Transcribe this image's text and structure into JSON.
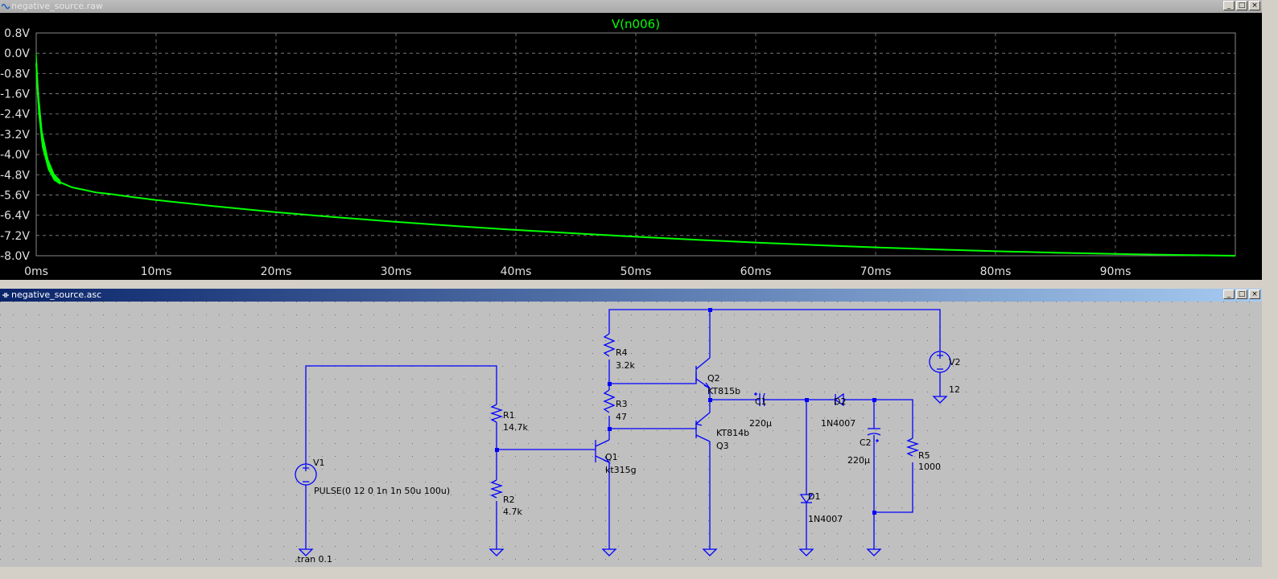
{
  "plot_window": {
    "title": "negative_source.raw",
    "buttons": [
      "_",
      "□",
      "×"
    ]
  },
  "schematic_window": {
    "title": "negative_source.asc",
    "buttons": [
      "_",
      "□",
      "×"
    ]
  },
  "chart_data": {
    "type": "line",
    "title": "V(n006)",
    "xlabel": "",
    "ylabel": "",
    "x_unit": "ms",
    "xlim": [
      0,
      100
    ],
    "ylim": [
      -8.0,
      0.8
    ],
    "x_ticks": [
      "0ms",
      "10ms",
      "20ms",
      "30ms",
      "40ms",
      "50ms",
      "60ms",
      "70ms",
      "80ms",
      "90ms"
    ],
    "y_ticks": [
      "0.8V",
      "0.0V",
      "-0.8V",
      "-1.6V",
      "-2.4V",
      "-3.2V",
      "-4.0V",
      "-4.8V",
      "-5.6V",
      "-6.4V",
      "-7.2V",
      "-8.0V"
    ],
    "grid": true,
    "colors": {
      "trace": "#00ff00",
      "grid": "#888888",
      "background": "#000000",
      "title": "#00ff00"
    },
    "series": [
      {
        "name": "V(n006)",
        "x": [
          0,
          0.2,
          0.5,
          1,
          1.5,
          2,
          3,
          4,
          5,
          6,
          8,
          10,
          15,
          20,
          25,
          30,
          35,
          40,
          45,
          50,
          55,
          60,
          65,
          70,
          75,
          80,
          85,
          90,
          95,
          100
        ],
        "y": [
          -0.4,
          -2.0,
          -3.4,
          -4.4,
          -4.9,
          -5.1,
          -5.3,
          -5.4,
          -5.5,
          -5.55,
          -5.68,
          -5.8,
          -6.05,
          -6.28,
          -6.48,
          -6.66,
          -6.83,
          -6.98,
          -7.12,
          -7.25,
          -7.37,
          -7.48,
          -7.58,
          -7.67,
          -7.75,
          -7.82,
          -7.88,
          -7.93,
          -7.97,
          -8.0
        ]
      }
    ],
    "ripple_region_ms": [
      0,
      2
    ]
  },
  "schematic": {
    "components": {
      "V1": {
        "name": "V1",
        "value": "PULSE(0 12 0 1n 1n 50u 100u)"
      },
      "V2": {
        "name": "V2",
        "value": "12"
      },
      "R1": {
        "name": "R1",
        "value": "14.7k"
      },
      "R2": {
        "name": "R2",
        "value": "4.7k"
      },
      "R3": {
        "name": "R3",
        "value": "47"
      },
      "R4": {
        "name": "R4",
        "value": "3.2k"
      },
      "R5": {
        "name": "R5",
        "value": "1000"
      },
      "Q1": {
        "name": "Q1",
        "value": "kt315g"
      },
      "Q2": {
        "name": "Q2",
        "value": "KT815b"
      },
      "Q3": {
        "name": "Q3",
        "value": "KT814b"
      },
      "C1": {
        "name": "C1",
        "value": "220µ"
      },
      "C2": {
        "name": "C2",
        "value": "220µ"
      },
      "D1": {
        "name": "D1",
        "value": "1N4007"
      },
      "D2": {
        "name": "D2",
        "value": "1N4007"
      }
    },
    "directive": ".tran 0.1",
    "wire_color": "#0000ff"
  }
}
